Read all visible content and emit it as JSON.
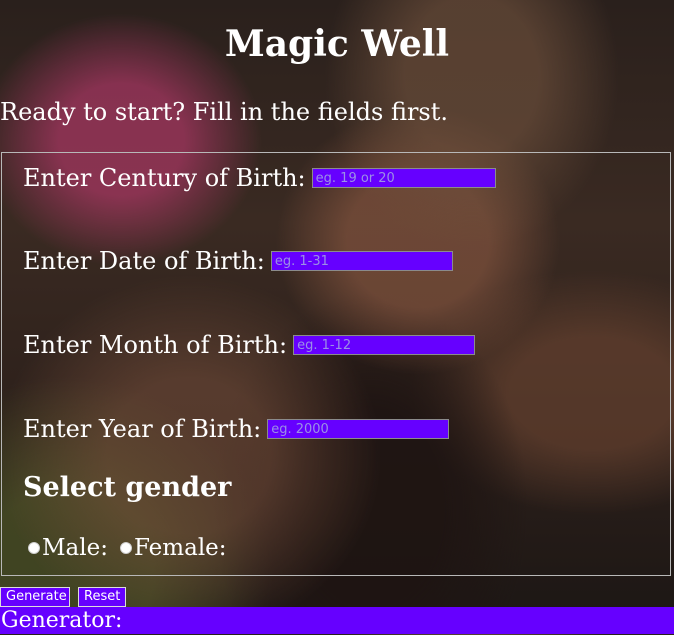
{
  "header": {
    "title": "Magic Well",
    "subtitle": "Ready to start? Fill in the fields first."
  },
  "form": {
    "century": {
      "label": "Enter Century of Birth:",
      "placeholder": "eg. 19 or 20",
      "value": ""
    },
    "date": {
      "label": "Enter Date of Birth:",
      "placeholder": "eg. 1-31",
      "value": ""
    },
    "month": {
      "label": "Enter Month of Birth:",
      "placeholder": "eg. 1-12",
      "value": ""
    },
    "year": {
      "label": "Enter Year of Birth:",
      "placeholder": "eg. 2000",
      "value": ""
    },
    "gender": {
      "heading": "Select gender",
      "options": [
        {
          "label": "Male:",
          "checked": false
        },
        {
          "label": "Female:",
          "checked": false
        }
      ]
    }
  },
  "actions": {
    "generate_label": "Generate",
    "reset_label": "Reset"
  },
  "output": {
    "label": "Generator:"
  },
  "colors": {
    "accent": "#6600ff",
    "text": "#ffffff"
  }
}
